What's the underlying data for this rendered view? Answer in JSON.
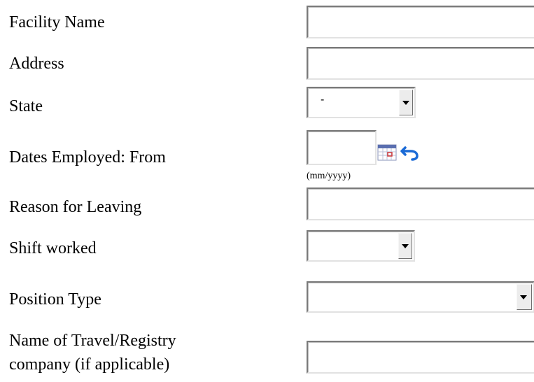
{
  "form": {
    "facility_name": {
      "label": "Facility Name",
      "value": ""
    },
    "address": {
      "label": "Address",
      "value": ""
    },
    "state": {
      "label": "State",
      "selected": "-"
    },
    "dates_employed": {
      "label": "Dates Employed: From",
      "value": "",
      "format_hint": "(mm/yyyy)",
      "calendar_icon": "calendar-icon",
      "reset_icon": "undo-icon"
    },
    "reason_for_leaving": {
      "label": "Reason for Leaving",
      "value": ""
    },
    "shift_worked": {
      "label": "Shift worked",
      "selected": ""
    },
    "position_type": {
      "label": "Position Type",
      "selected": ""
    },
    "travel_registry": {
      "label_line1": "Name of Travel/Registry",
      "label_line2": "company (if applicable)",
      "value": ""
    }
  },
  "colors": {
    "calendar_header": "#5b6fb0",
    "calendar_accent": "#d23b3b",
    "undo_arrow": "#1a6ad6"
  }
}
